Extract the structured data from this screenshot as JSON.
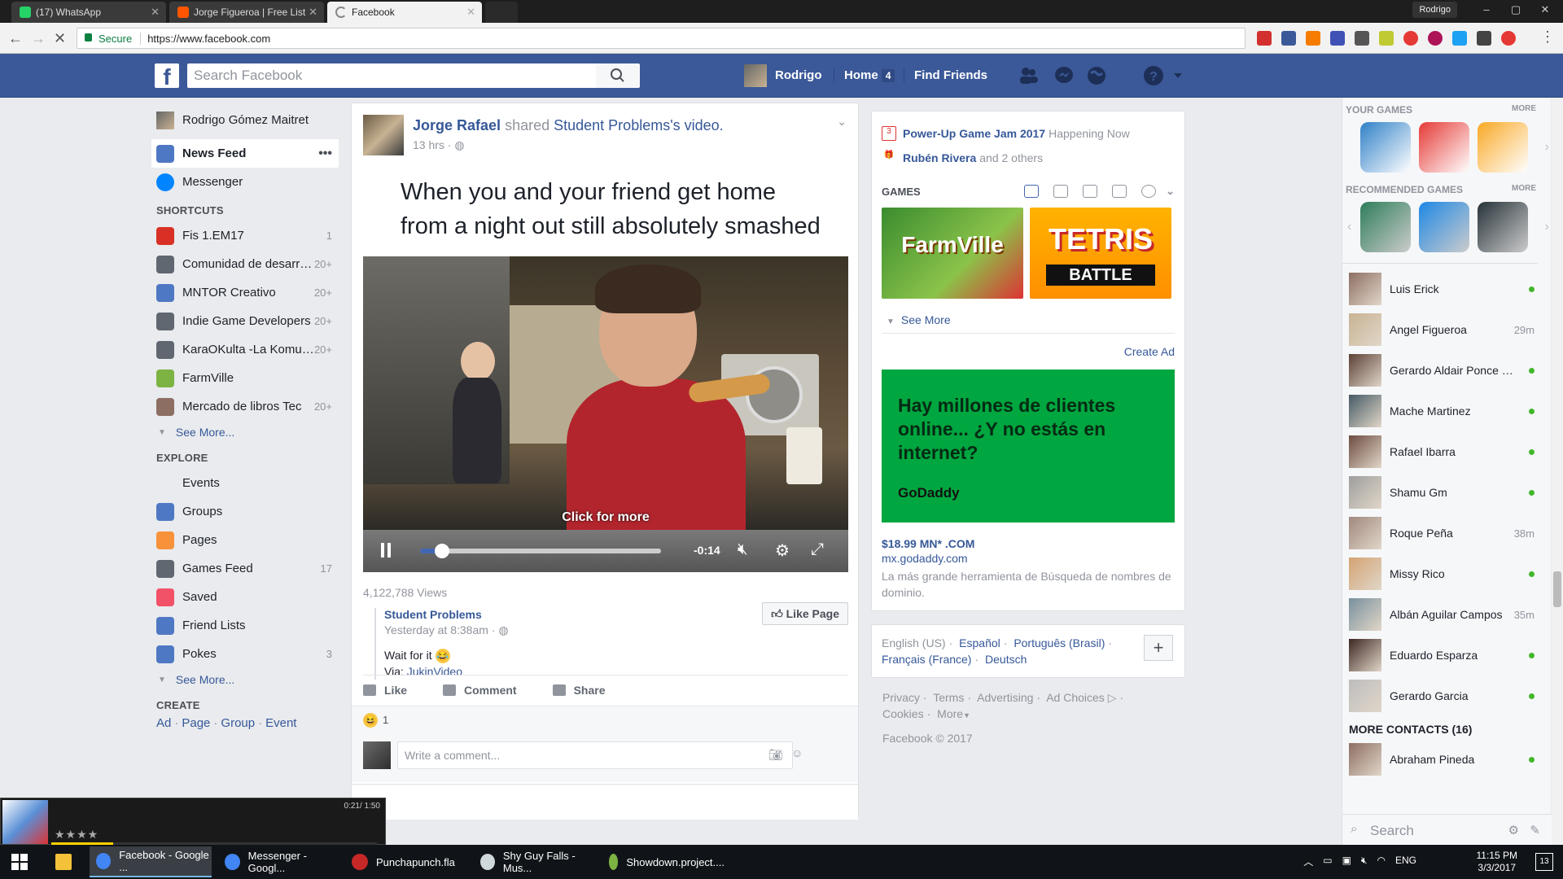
{
  "browser": {
    "tabs": [
      {
        "label": "(17) WhatsApp",
        "color": "#25d366"
      },
      {
        "label": "Jorge Figueroa | Free List",
        "color": "#ff5500"
      },
      {
        "label": "Facebook",
        "color": "#3b5998"
      }
    ],
    "profile": "Rodrigo",
    "secure_label": "Secure",
    "url": "https://www.facebook.com",
    "window_controls": [
      "–",
      "▢",
      "✕"
    ]
  },
  "header": {
    "search_placeholder": "Search Facebook",
    "user_name": "Rodrigo",
    "home_label": "Home",
    "home_count": "4",
    "find_friends_label": "Find Friends"
  },
  "left_nav": {
    "profile_name": "Rodrigo Gómez Maitret",
    "main_items": [
      {
        "label": "News Feed",
        "extra": "•••",
        "icon": "news-feed-icon"
      },
      {
        "label": "Messenger",
        "extra": "",
        "icon": "messenger-icon"
      }
    ],
    "shortcuts_header": "SHORTCUTS",
    "shortcuts": [
      {
        "label": "Fis 1.EM17",
        "count": "1",
        "icon": "apple-icon",
        "color": "#d93025"
      },
      {
        "label": "Comunidad de desarr…",
        "count": "20+",
        "icon": "gamepad-icon",
        "color": "#606770"
      },
      {
        "label": "MNTOR Creativo",
        "count": "20+",
        "icon": "group-icon",
        "color": "#4f78c4"
      },
      {
        "label": "Indie Game Developers",
        "count": "20+",
        "icon": "gamepad-icon",
        "color": "#606770"
      },
      {
        "label": "KaraOKulta -La Komu…",
        "count": "20+",
        "icon": "gamepad-icon",
        "color": "#606770"
      },
      {
        "label": "FarmVille",
        "count": "",
        "icon": "farmville-icon",
        "color": "#7cb342"
      },
      {
        "label": "Mercado de libros Tec",
        "count": "20+",
        "icon": "books-icon",
        "color": "#8d6e63"
      }
    ],
    "see_more": "See More...",
    "explore_header": "EXPLORE",
    "explore": [
      {
        "label": "Events",
        "count": "",
        "icon": "calendar-icon",
        "color": "#e9ebee"
      },
      {
        "label": "Groups",
        "count": "",
        "icon": "group-icon",
        "color": "#4f78c4"
      },
      {
        "label": "Pages",
        "count": "",
        "icon": "flag-icon",
        "color": "#f7923b"
      },
      {
        "label": "Games Feed",
        "count": "17",
        "icon": "gamepad-icon",
        "color": "#606770"
      },
      {
        "label": "Saved",
        "count": "",
        "icon": "bookmark-icon",
        "color": "#f25268"
      },
      {
        "label": "Friend Lists",
        "count": "",
        "icon": "friend-list-icon",
        "color": "#4f78c4"
      },
      {
        "label": "Pokes",
        "count": "3",
        "icon": "poke-icon",
        "color": "#4f78c4"
      }
    ],
    "see_more_2": "See More...",
    "create_header": "CREATE",
    "create_links": [
      "Ad",
      "Page",
      "Group",
      "Event"
    ]
  },
  "post": {
    "author": "Jorge Rafael",
    "shared_word": "shared",
    "source": "Student Problems",
    "video_word": "'s video.",
    "time": "13 hrs",
    "caption": "When you and your friend get home from a night out still absolutely smashed",
    "video_overlay": "Click for more",
    "video_time": "-0:14",
    "video_progress": 0.09,
    "views": "4,122,788 Views",
    "shared_page": "Student Problems",
    "shared_time": "Yesterday at 8:38am",
    "shared_text": "Wait for it",
    "shared_via_label": "Via:",
    "shared_via_link": "JukinVideo",
    "like_page": "Like Page",
    "actions": [
      "Like",
      "Comment",
      "Share"
    ],
    "reaction_count": "1",
    "comment_placeholder": "Write a comment..."
  },
  "right": {
    "events": [
      {
        "title": "Power-Up Game Jam 2017",
        "suffix": "Happening Now",
        "icon": "3"
      },
      {
        "title": "Rubén Rivera",
        "suffix": "and 2 others",
        "icon": "🎁"
      }
    ],
    "games_header": "GAMES",
    "game_tiles": [
      {
        "name": "FarmVille",
        "label": "FarmVille"
      },
      {
        "name": "Tetris Battle",
        "label": "TETRIS",
        "label2": "BATTLE"
      }
    ],
    "see_more": "See More",
    "create_ad": "Create Ad",
    "ad": {
      "headline": "Hay millones de clientes online... ¿Y no estás en internet?",
      "brand": "GoDaddy",
      "title": "$18.99 MN* .COM",
      "domain": "mx.godaddy.com",
      "body": "La más grande herramienta de Búsqueda de nombres de dominio."
    },
    "languages": {
      "current": "English (US)",
      "links": [
        "Español",
        "Português (Brasil)",
        "Français (France)",
        "Deutsch"
      ]
    },
    "footer_links": [
      "Privacy",
      "Terms",
      "Advertising",
      "Ad Choices",
      "Cookies",
      "More"
    ],
    "copyright": "Facebook © 2017"
  },
  "chat": {
    "your_games": "YOUR GAMES",
    "more": "MORE",
    "recommended_games": "RECOMMENDED GAMES",
    "your_game_colors": [
      "#2f80c7",
      "#e53935",
      "#f9a825"
    ],
    "recommended_colors": [
      "#2e7d5a",
      "#1e88e5",
      "#263238"
    ],
    "contacts": [
      {
        "name": "Luis Erick",
        "status": "online",
        "time": ""
      },
      {
        "name": "Angel Figueroa",
        "status": "away",
        "time": "29m"
      },
      {
        "name": "Gerardo Aldair Ponce …",
        "status": "online",
        "time": ""
      },
      {
        "name": "Mache Martinez",
        "status": "online",
        "time": ""
      },
      {
        "name": "Rafael Ibarra",
        "status": "online",
        "time": ""
      },
      {
        "name": "Shamu Gm",
        "status": "online",
        "time": ""
      },
      {
        "name": "Roque Peña",
        "status": "away",
        "time": "38m"
      },
      {
        "name": "Missy Rico",
        "status": "online",
        "time": ""
      },
      {
        "name": "Albán Aguilar Campos",
        "status": "away",
        "time": "35m"
      },
      {
        "name": "Eduardo Esparza",
        "status": "online",
        "time": ""
      },
      {
        "name": "Gerardo Garcia",
        "status": "online",
        "time": ""
      }
    ],
    "more_contacts": "MORE CONTACTS (16)",
    "more_contact_list": [
      {
        "name": "Abraham Pineda",
        "status": "online",
        "time": ""
      }
    ],
    "search_placeholder": "Search"
  },
  "media": {
    "time": "0:21/ 1:50",
    "stars": "★★★★",
    "progress": 0.19
  },
  "taskbar": {
    "items": [
      {
        "label": "Facebook - Google ...",
        "color": "#4285f4",
        "active": true
      },
      {
        "label": "Messenger - Googl...",
        "color": "#4285f4",
        "active": false
      },
      {
        "label": "Punchapunch.fla",
        "color": "#c62828",
        "active": false
      },
      {
        "label": "Shy Guy Falls - Mus...",
        "color": "#cfd8dc",
        "active": false
      },
      {
        "label": "Showdown.project....",
        "color": "#7cb342",
        "active": false
      }
    ],
    "language": "ENG",
    "time": "11:15 PM",
    "date": "3/3/2017",
    "notifications": "13"
  }
}
